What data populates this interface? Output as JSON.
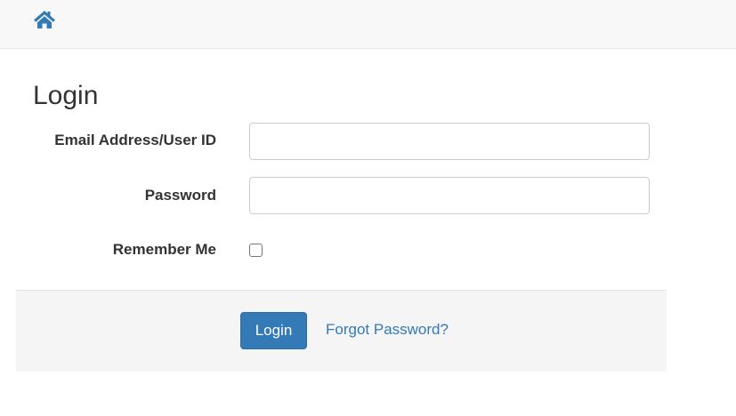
{
  "navbar": {
    "home_icon": "home-icon",
    "accent_color": "#337ab7"
  },
  "page": {
    "title": "Login"
  },
  "form": {
    "email_label": "Email Address/User ID",
    "email_value": "",
    "password_label": "Password",
    "password_value": "",
    "remember_label": "Remember Me",
    "remember_checked": false
  },
  "footer": {
    "login_button_label": "Login",
    "forgot_password_link": "Forgot Password?"
  }
}
